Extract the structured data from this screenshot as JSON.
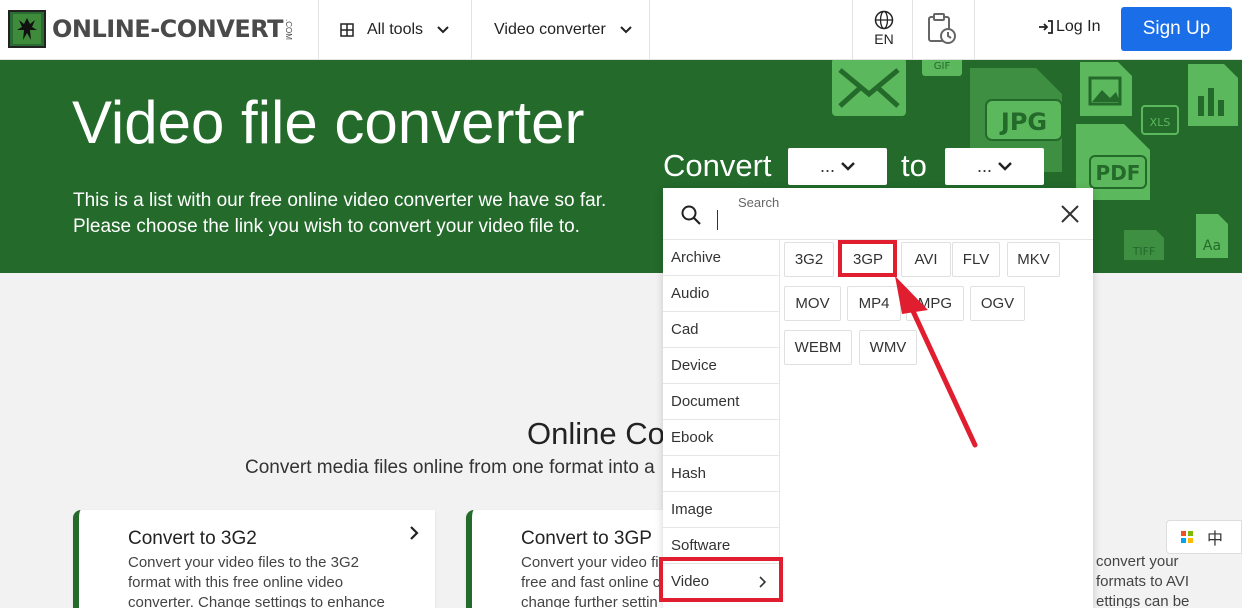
{
  "header": {
    "logo_text": "ONLINE-CONVERT",
    "logo_sub": ".COM",
    "menu": [
      {
        "label": "All tools"
      },
      {
        "label": "Video converter"
      }
    ],
    "language": "EN",
    "login_label": "Log In",
    "signup_label": "Sign Up"
  },
  "hero": {
    "title": "Video file converter",
    "description_line1": "This is a list with our free online video converter we have so far.",
    "description_line2": "Please choose the link you wish to convert your video file to.",
    "convert_label": "Convert",
    "to_label": "to",
    "from_select_value": "...",
    "to_select_value": "...",
    "deco_labels": [
      "GIF",
      "JPG",
      "PDF",
      "XLS",
      "TIFF",
      "Aa"
    ]
  },
  "dropdown": {
    "search_label": "Search",
    "categories": [
      "Archive",
      "Audio",
      "Cad",
      "Device",
      "Document",
      "Ebook",
      "Hash",
      "Image",
      "Software",
      "Video"
    ],
    "active_category": "Video",
    "formats": [
      "3G2",
      "3GP",
      "AVI",
      "FLV",
      "MKV",
      "MOV",
      "MP4",
      "MPG",
      "OGV",
      "WEBM",
      "WMV"
    ],
    "highlighted_format": "3GP"
  },
  "section": {
    "title": "Online Co",
    "subtitle": "Convert media files online from one format into a",
    "cards": [
      {
        "title": "Convert to 3G2",
        "line1": "Convert your video files to the 3G2",
        "line2": "format with this free online video",
        "line3": "converter. Change settings to enhance"
      },
      {
        "title": "Convert to 3GP",
        "line1": "Convert your video fi",
        "line2": "free and fast online c",
        "line3": "change further settin"
      }
    ],
    "card3_line1": "convert your",
    "card3_line2": "formats to AVI",
    "card3_line3": "ettings can be"
  },
  "ime": {
    "label": "中"
  },
  "colors": {
    "brand_green": "#236a2b",
    "primary_blue": "#1a6fe8",
    "highlight_red": "#e01e2f"
  }
}
